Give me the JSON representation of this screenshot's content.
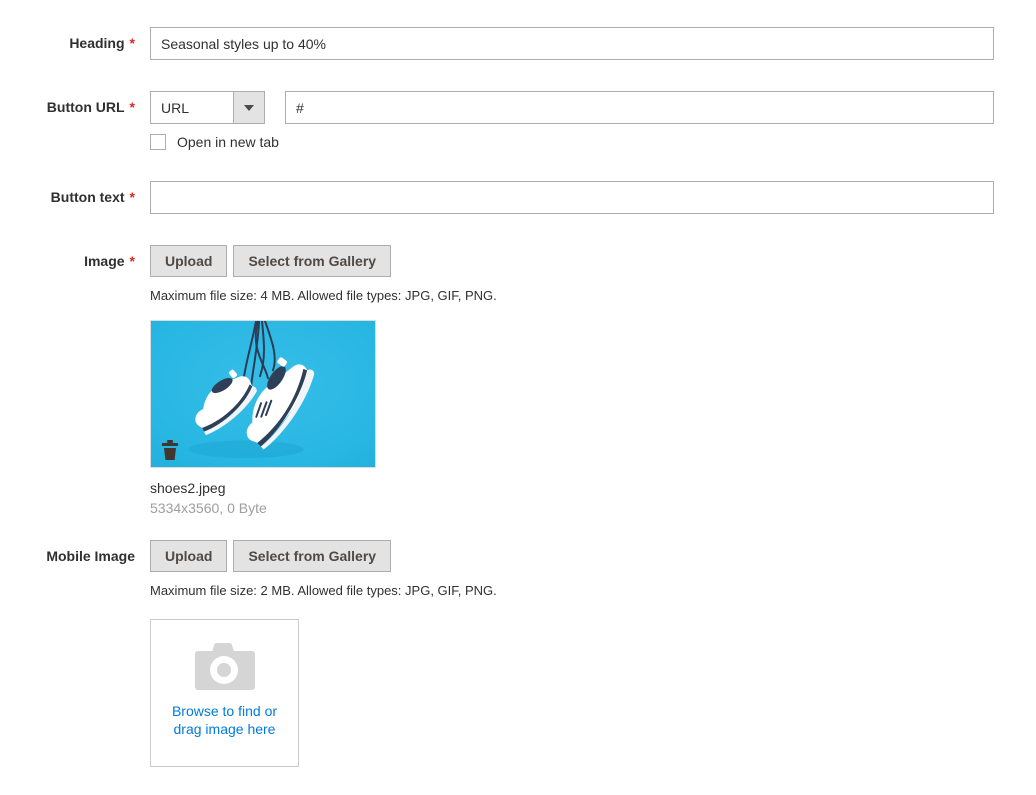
{
  "colors": {
    "required_red": "#e22626",
    "link_blue": "#007bdb",
    "button_bg": "#e3e3e3",
    "button_text": "#514943",
    "input_border": "#adadad",
    "image_background_cyan": "#27b6e2",
    "shoe_accent_navy": "#2e4058"
  },
  "form": {
    "heading": {
      "label": "Heading",
      "required": "*",
      "value": "Seasonal styles up to 40%"
    },
    "button_url": {
      "label": "Button URL",
      "required": "*",
      "select_value": "URL",
      "url_value": "#",
      "checkbox_label": "Open in new tab",
      "checkbox_checked": false
    },
    "button_text": {
      "label": "Button text",
      "required": "*",
      "value": ""
    },
    "image": {
      "label": "Image",
      "required": "*",
      "upload_label": "Upload",
      "gallery_label": "Select from Gallery",
      "note": "Maximum file size: 4 MB. Allowed file types: JPG, GIF, PNG.",
      "preview_alt": "white sneakers hanging by laces on cyan background",
      "file_name": "shoes2.jpeg",
      "file_meta": "5334x3560, 0 Byte"
    },
    "mobile_image": {
      "label": "Mobile Image",
      "upload_label": "Upload",
      "gallery_label": "Select from Gallery",
      "note": "Maximum file size: 2 MB. Allowed file types: JPG, GIF, PNG.",
      "dropzone_line1": "Browse to find or",
      "dropzone_line2": "drag image here"
    }
  }
}
